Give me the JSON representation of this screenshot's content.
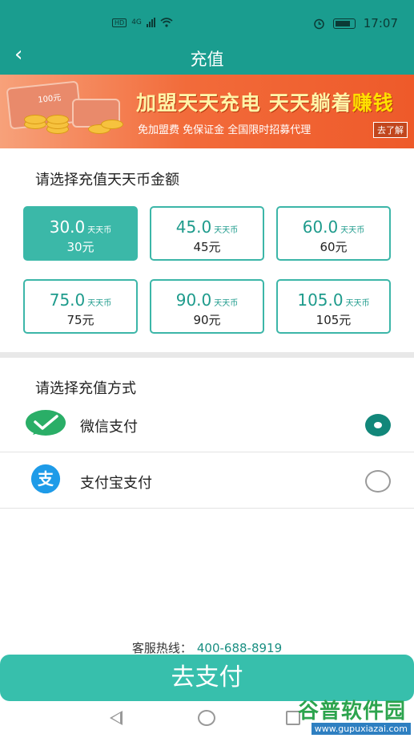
{
  "status_bar": {
    "hd": "HD",
    "network": "4G",
    "time": "17:07"
  },
  "header": {
    "title": "充值"
  },
  "banner": {
    "bill_text": "100元",
    "headline_part1": "加盟天天充电 天天躺着",
    "headline_part2": "赚钱",
    "subtitle": "免加盟费 免保证金 全国限时招募代理",
    "badge": "去了解"
  },
  "amount_section": {
    "title": "请选择充值天天币金额",
    "unit": "天天币",
    "options": [
      {
        "coins": "30.0",
        "price": "30元",
        "selected": true
      },
      {
        "coins": "45.0",
        "price": "45元",
        "selected": false
      },
      {
        "coins": "60.0",
        "price": "60元",
        "selected": false
      },
      {
        "coins": "75.0",
        "price": "75元",
        "selected": false
      },
      {
        "coins": "90.0",
        "price": "90元",
        "selected": false
      },
      {
        "coins": "105.0",
        "price": "105元",
        "selected": false
      }
    ]
  },
  "payment_section": {
    "title": "请选择充值方式",
    "methods": [
      {
        "label": "微信支付",
        "icon": "wechat-pay-icon",
        "checked": true
      },
      {
        "label": "支付宝支付",
        "icon": "alipay-icon",
        "glyph": "支",
        "checked": false
      }
    ]
  },
  "hotline": {
    "label": "客服热线：",
    "phone": "400-688-8919"
  },
  "submit_label": "去支付",
  "watermark": {
    "text": "谷普软件园",
    "url": "www.gupuxiazai.com"
  },
  "colors": {
    "primary": "#1a9d8f",
    "accent": "#37bfac",
    "banner_orange": "#f26b3a",
    "wechat_green": "#2aae67",
    "alipay_blue": "#1e9be8"
  }
}
